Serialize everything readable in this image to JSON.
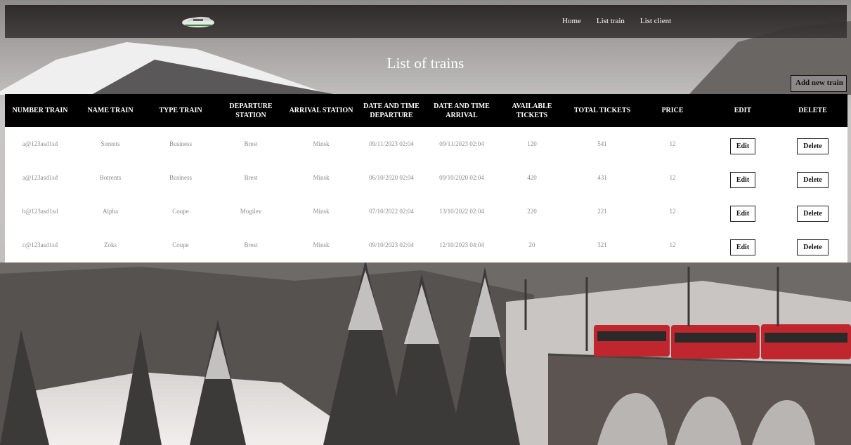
{
  "navbar": {
    "links": [
      "Home",
      "List train",
      "List client"
    ]
  },
  "page": {
    "title": "List of trains",
    "add_button_label": "Add new train"
  },
  "table": {
    "headers": [
      "NUMBER TRAIN",
      "NAME TRAIN",
      "TYPE TRAIN",
      "DEPARTURE STATION",
      "ARRIVAL STATION",
      "DATE AND TIME DEPARTURE",
      "DATE AND TIME ARRIVAL",
      "AVAILABLE TICKETS",
      "TOTAL TICKETS",
      "PRICE",
      "EDIT",
      "DELETE"
    ],
    "rows": [
      [
        "a@123asd1sd",
        "Sorents",
        "Business",
        "Brest",
        "Minsk",
        "09/11/2023 02:04",
        "09/11/2023 02:04",
        "120",
        "541",
        "12"
      ],
      [
        "a@123asd1sd",
        "Botrents",
        "Business",
        "Brest",
        "Minsk",
        "06/10/2020 02:04",
        "09/10/2020 02:04",
        "420",
        "431",
        "12"
      ],
      [
        "b@123asd1sd",
        "Alpha",
        "Coupe",
        "Mogilev",
        "Minsk",
        "07/10/2022 02:04",
        "13/10/2022 02:04",
        "220",
        "221",
        "12"
      ],
      [
        "c@123asd1sd",
        "Zoks",
        "Coupe",
        "Brest",
        "Minsk",
        "09/10/2023 02:04",
        "12/10/2023 04:04",
        "20",
        "321",
        "12"
      ]
    ],
    "edit_label": "Edit",
    "delete_label": "Delete"
  }
}
